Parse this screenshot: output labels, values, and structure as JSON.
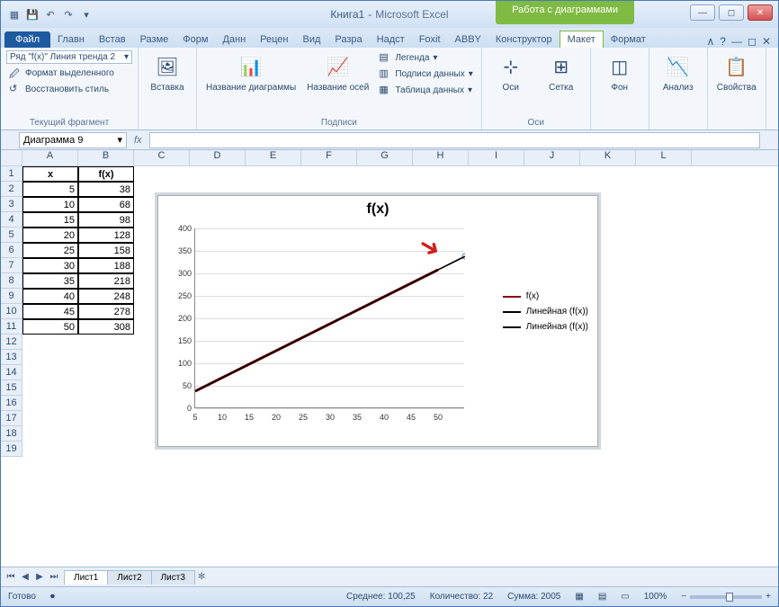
{
  "window": {
    "doc_title": "Книга1",
    "app_title": "Microsoft Excel",
    "chart_tools": "Работа с диаграммами"
  },
  "tabs": {
    "file": "Файл",
    "items": [
      "Главн",
      "Встав",
      "Разме",
      "Форм",
      "Данн",
      "Рецен",
      "Вид",
      "Разра",
      "Надст",
      "Foxit",
      "ABBY"
    ],
    "chart_items": [
      "Конструктор",
      "Макет",
      "Формат"
    ]
  },
  "ribbon": {
    "selection_combo": "Ряд \"f(x)\" Линия тренда 2",
    "format_selection": "Формат выделенного",
    "reset_style": "Восстановить стиль",
    "group_current": "Текущий фрагмент",
    "insert": "Вставка",
    "chart_title": "Название диаграммы",
    "axis_titles": "Название осей",
    "legend": "Легенда",
    "data_labels": "Подписи данных",
    "data_table": "Таблица данных",
    "group_labels": "Подписи",
    "axes": "Оси",
    "grid": "Сетка",
    "group_axes": "Оси",
    "background": "Фон",
    "analysis": "Анализ",
    "properties": "Свойства"
  },
  "name_box": "Диаграмма 9",
  "sheet_data": {
    "headers": {
      "A": "x",
      "B": "f(x)"
    },
    "rows": [
      {
        "x": "5",
        "fx": "38"
      },
      {
        "x": "10",
        "fx": "68"
      },
      {
        "x": "15",
        "fx": "98"
      },
      {
        "x": "20",
        "fx": "128"
      },
      {
        "x": "25",
        "fx": "158"
      },
      {
        "x": "30",
        "fx": "188"
      },
      {
        "x": "35",
        "fx": "218"
      },
      {
        "x": "40",
        "fx": "248"
      },
      {
        "x": "45",
        "fx": "278"
      },
      {
        "x": "50",
        "fx": "308"
      }
    ]
  },
  "columns": [
    "A",
    "B",
    "C",
    "D",
    "E",
    "F",
    "G",
    "H",
    "I",
    "J",
    "K",
    "L"
  ],
  "chart_data": {
    "type": "line",
    "title": "f(x)",
    "x": [
      5,
      10,
      15,
      20,
      25,
      30,
      35,
      40,
      45,
      50
    ],
    "series": [
      {
        "name": "f(x)",
        "values": [
          38,
          68,
          98,
          128,
          158,
          188,
          218,
          248,
          278,
          308
        ],
        "color": "#8b0000"
      },
      {
        "name": "Линейная (f(x))",
        "values": [
          38,
          68,
          98,
          128,
          158,
          188,
          218,
          248,
          278,
          308,
          338
        ],
        "color": "#000000",
        "x": [
          5,
          10,
          15,
          20,
          25,
          30,
          35,
          40,
          45,
          50,
          55
        ]
      },
      {
        "name": "Линейная (f(x))",
        "values": [
          38,
          68,
          98,
          128,
          158,
          188,
          218,
          248,
          278,
          308,
          338
        ],
        "color": "#000000",
        "x": [
          5,
          10,
          15,
          20,
          25,
          30,
          35,
          40,
          45,
          50,
          55
        ]
      }
    ],
    "y_ticks": [
      0,
      50,
      100,
      150,
      200,
      250,
      300,
      350,
      400
    ],
    "x_ticks": [
      5,
      10,
      15,
      20,
      25,
      30,
      35,
      40,
      45,
      50
    ],
    "ylim": [
      0,
      400
    ],
    "xlim": [
      5,
      55
    ]
  },
  "sheets": {
    "active": "Лист1",
    "others": [
      "Лист2",
      "Лист3"
    ]
  },
  "status": {
    "ready": "Готово",
    "average_label": "Среднее:",
    "average": "100,25",
    "count_label": "Количество:",
    "count": "22",
    "sum_label": "Сумма:",
    "sum": "2005",
    "zoom": "100%"
  }
}
